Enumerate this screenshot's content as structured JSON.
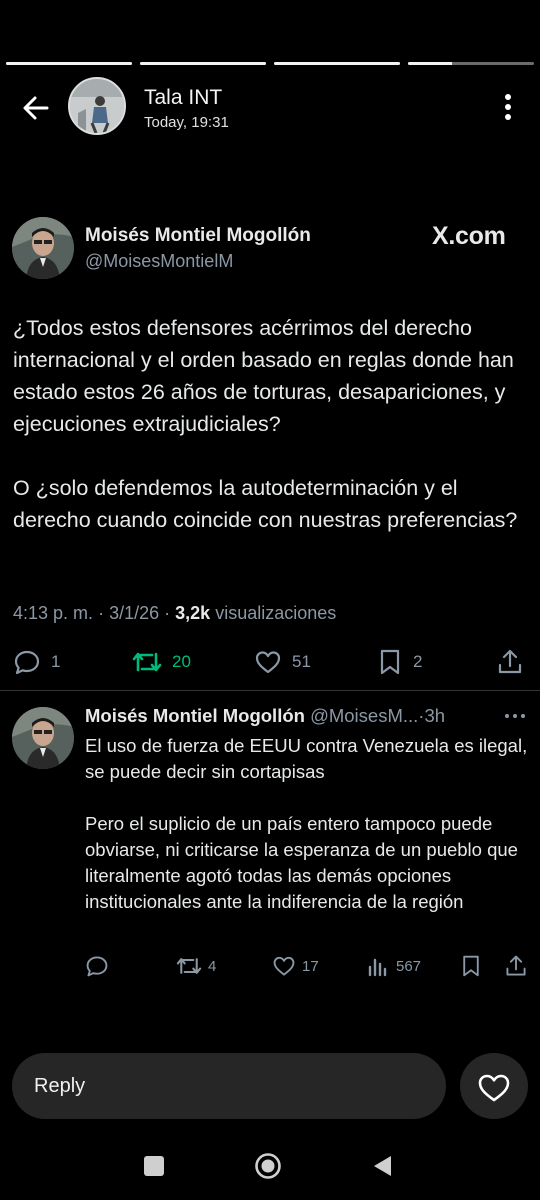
{
  "story": {
    "progress": [
      1,
      1,
      1,
      0.35
    ],
    "account_name": "Tala INT",
    "timestamp": "Today, 19:31",
    "icons": {
      "back": "arrow-left-icon",
      "menu": "kebab-icon"
    }
  },
  "tweet": {
    "author_name": "Moisés Montiel Mogollón",
    "author_handle": "@MoisesMontielM",
    "brand": "X.com",
    "paragraphs": [
      "¿Todos estos defensores acérrimos del derecho internacional y el orden basado en reglas donde han estado estos 26 años de torturas, desapariciones, y ejecuciones extrajudiciales?",
      "O ¿solo defendemos la autodeterminación y el derecho cuando coincide con nuestras preferencias?"
    ],
    "time": "4:13 p. m.",
    "date": "3/1/26",
    "separator": "·",
    "views_count": "3,2k",
    "views_label": "visualizaciones",
    "replies": "1",
    "retweets": "20",
    "likes": "51",
    "bookmarks": "2",
    "retweet_color": "#00ba7c"
  },
  "reply": {
    "author_name": "Moisés Montiel Mogollón",
    "author_handle": "@MoisesM...",
    "age": "3h",
    "paragraphs": [
      "El uso de fuerza de EEUU contra Venezuela es ilegal, se puede decir sin cortapisas",
      "Pero el suplicio de un país entero tampoco puede obviarse, ni criticarse la esperanza de un pueblo que literalmente agotó todas las demás opciones institucionales ante la indiferencia de la región"
    ],
    "replies": "",
    "retweets": "4",
    "likes": "17",
    "views": "567"
  },
  "reply_bar": {
    "placeholder": "Reply"
  }
}
